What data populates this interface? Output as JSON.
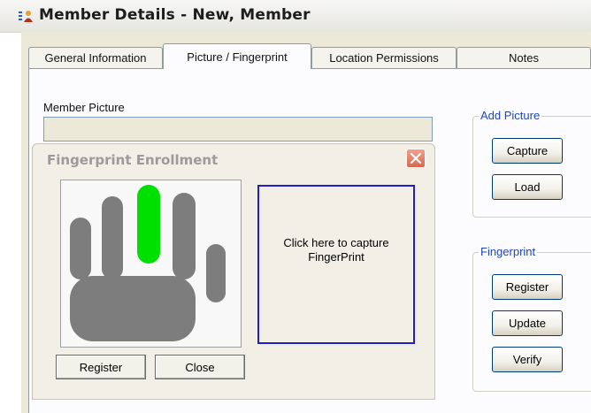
{
  "window": {
    "title": "Member Details - New, Member"
  },
  "tabs": [
    {
      "label": "General Information"
    },
    {
      "label": "Picture / Fingerprint"
    },
    {
      "label": "Location Permissions"
    },
    {
      "label": "Notes"
    }
  ],
  "picture_section": {
    "label": "Member Picture"
  },
  "add_picture": {
    "title": "Add Picture",
    "capture_label": "Capture",
    "load_label": "Load"
  },
  "fingerprint_group": {
    "title": "Fingerprint",
    "register_label": "Register",
    "update_label": "Update",
    "verify_label": "Verify"
  },
  "enrollment_dialog": {
    "title": "Fingerprint Enrollment",
    "capture_prompt_line1": "Click here to capture",
    "capture_prompt_line2": "FingerPrint",
    "register_label": "Register",
    "close_label": "Close"
  },
  "colors": {
    "selected_finger": "#00e000",
    "finger": "#7d7d7d",
    "group_title": "#1f45b8",
    "capture_border": "#2020c8"
  }
}
